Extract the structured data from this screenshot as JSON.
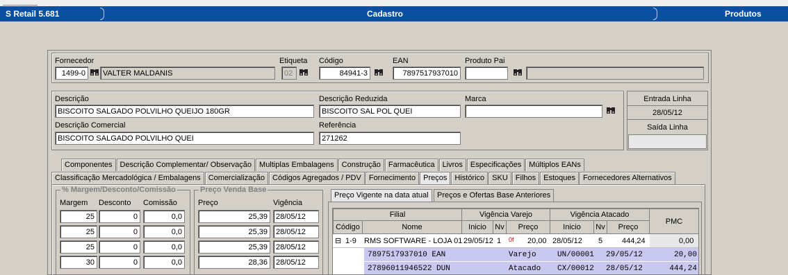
{
  "titlebar": {
    "app": "S Retail 5.681",
    "module": "Cadastro",
    "section": "Produtos"
  },
  "fornecedor": {
    "label": "Fornecedor",
    "code": "1499-0",
    "name": "VALTER MALDANIS"
  },
  "etiqueta": {
    "label": "Etiqueta",
    "value": "02"
  },
  "codigo": {
    "label": "Código",
    "value": "84941-3"
  },
  "ean": {
    "label": "EAN",
    "value": "7897517937010"
  },
  "produto_pai": {
    "label": "Produto Pai",
    "value": "",
    "name": ""
  },
  "descricao": {
    "label": "Descrição",
    "value": "BISCOITO SALGADO POLVILHO QUEIJO 180GR"
  },
  "descricao_reduzida": {
    "label": "Descrição Reduzida",
    "value": "BISCOITO SAL POL QUEI"
  },
  "marca": {
    "label": "Marca",
    "value": ""
  },
  "descricao_comercial": {
    "label": "Descrição Comercial",
    "value": "BISCOITO SALGADO POLVILHO QUEI"
  },
  "referencia": {
    "label": "Referência",
    "value": "271262"
  },
  "linha": {
    "entrada_label": "Entrada Linha",
    "entrada": "28/05/12",
    "saida_label": "Saída Linha",
    "saida": ""
  },
  "tabs_row1": [
    "Componentes",
    "Descrição Complementar/ Observação",
    "Multiplas Embalagens",
    "Construção",
    "Farmacêutica",
    "Livros",
    "Especificações",
    "Múltiplos EANs"
  ],
  "tabs_row2": [
    "Classificação Mercadológica / Embalagens",
    "Comercialização",
    "Códigos Agregados / PDV",
    "Fornecimento",
    "Preços",
    "Histórico",
    "SKU",
    "Filhos",
    "Estoques",
    "Fornecedores Alternativos"
  ],
  "margem_group": {
    "title": "% Margem/Desconto/Comissão",
    "cols": [
      "Margem",
      "Desconto",
      "Comissão"
    ],
    "rows": [
      [
        "25",
        "0",
        "0,0"
      ],
      [
        "25",
        "0",
        "0,0"
      ],
      [
        "25",
        "0",
        "0,0"
      ],
      [
        "30",
        "0",
        "0,0"
      ]
    ]
  },
  "preco_group": {
    "title": "Preço Venda Base",
    "cols": [
      "Preço",
      "Vigência"
    ],
    "rows": [
      [
        "25,39",
        "28/05/12"
      ],
      [
        "25,39",
        "28/05/12"
      ],
      [
        "25,39",
        "28/05/12"
      ],
      [
        "28,36",
        "28/05/12"
      ]
    ]
  },
  "preco_tabs": [
    "Preço Vigente na data atual",
    "Preços e Ofertas Base Anteriores"
  ],
  "grid": {
    "h_filial": "Filial",
    "h_varejo": "Vigência Varejo",
    "h_atacado": "Vigência Atacado",
    "h_pmc": "PMC",
    "h_codigo": "Código",
    "h_nome": "Nome",
    "h_inicio": "Inicio",
    "h_nv": "Nv",
    "h_preco": "Preço",
    "h_inicio2": "Inicio",
    "h_nv2": "Nv",
    "h_preco2": "Preço",
    "row": {
      "expand": "⊟",
      "codigo": "1-9",
      "nome": "RMS SOFTWARE - LOJA 01",
      "inicio": "29/05/12",
      "nv": "1",
      "flag": "0f",
      "preco": "20,00",
      "inicio2": "28/05/12",
      "nv2": "5",
      "preco2": "444,24",
      "pmc": "0,00"
    },
    "sub": [
      {
        "code": "7897517937010 EAN",
        "tipo": "Varejo",
        "emb": "UN/00001",
        "data": "29/05/12",
        "valor": "20,00"
      },
      {
        "code": "27896011946522 DUN",
        "tipo": "Atacado",
        "emb": "CX/00012",
        "data": "28/05/12",
        "valor": "444,24"
      }
    ]
  }
}
